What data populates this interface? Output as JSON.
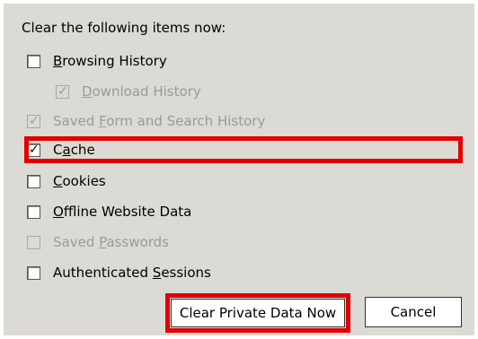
{
  "dialog": {
    "heading": "Clear the following items now:",
    "items": [
      {
        "label": "Browsing History",
        "access_key": "B",
        "checked": false,
        "enabled": true
      },
      {
        "label": "Download History",
        "access_key": "D",
        "checked": true,
        "enabled": false
      },
      {
        "label": "Saved Form and Search History",
        "access_key": "F",
        "checked": true,
        "enabled": false
      },
      {
        "label": "Cache",
        "access_key": "a",
        "checked": true,
        "enabled": true
      },
      {
        "label": "Cookies",
        "access_key": "C",
        "checked": false,
        "enabled": true
      },
      {
        "label": "Offline Website Data",
        "access_key": "O",
        "checked": false,
        "enabled": true
      },
      {
        "label": "Saved Passwords",
        "access_key": "P",
        "checked": false,
        "enabled": false
      },
      {
        "label": "Authenticated Sessions",
        "access_key": "S",
        "checked": false,
        "enabled": true
      }
    ],
    "buttons": {
      "clear_label": "Clear Private Data Now",
      "cancel_label": "Cancel"
    }
  },
  "colors": {
    "panel_bg": "#dcdad4",
    "highlight": "#e00000",
    "disabled_text": "#9a9a9a"
  }
}
